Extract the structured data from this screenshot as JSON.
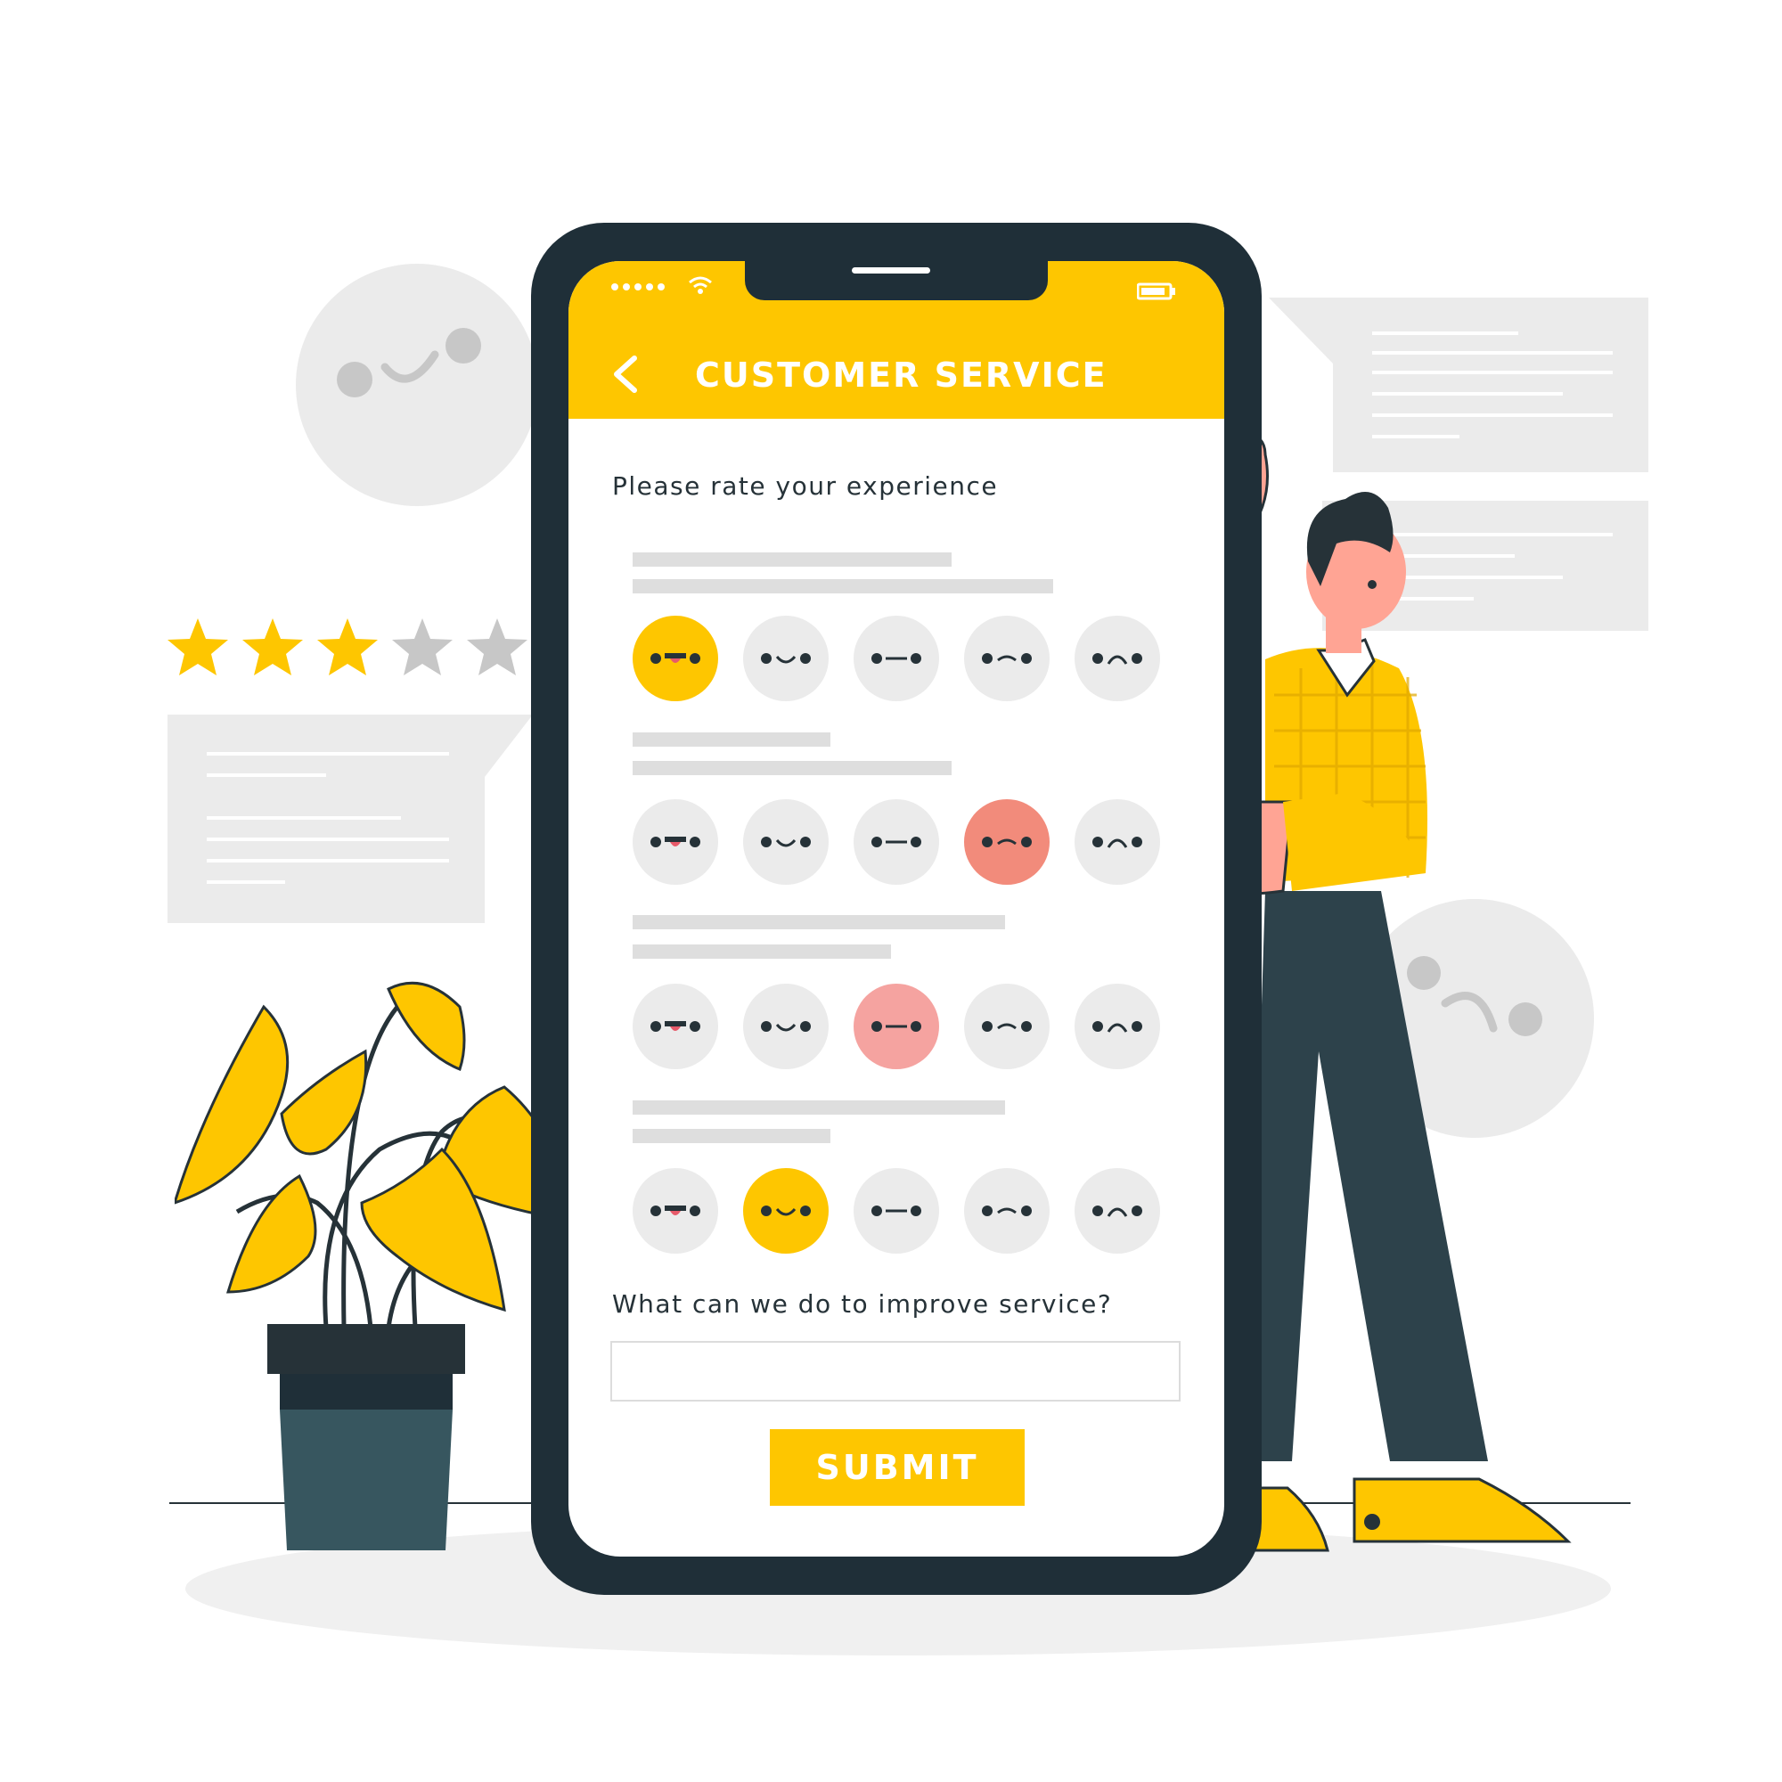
{
  "app": {
    "title": "CUSTOMER SERVICE",
    "back_icon": "chevron-left-icon"
  },
  "status_bar": {
    "signal_icon": "signal-dots-icon",
    "wifi_icon": "wifi-icon",
    "battery_icon": "battery-icon"
  },
  "survey": {
    "rate_prompt": "Please rate your experience",
    "scale": [
      "very-happy",
      "happy",
      "neutral",
      "unhappy",
      "very-unhappy"
    ],
    "questions": [
      {
        "selected_index": 0,
        "selected_color": "#fec600"
      },
      {
        "selected_index": 3,
        "selected_color": "#f28b7b"
      },
      {
        "selected_index": 2,
        "selected_color": "#f5a3a0"
      },
      {
        "selected_index": 1,
        "selected_color": "#fec600"
      }
    ],
    "improve_prompt": "What can we do to improve service?",
    "feedback_value": "",
    "submit_label": "SUBMIT"
  },
  "decorations": {
    "rating_stars": {
      "filled": 3,
      "total": 5
    },
    "icons": [
      "smiley-bubble-icon",
      "sad-bubble-icon",
      "star-icon",
      "chat-bubble-icon",
      "potted-plant-icon",
      "man-thumbs-down-icon"
    ]
  },
  "colors": {
    "accent": "#fec600",
    "phone_frame": "#1f2f38",
    "face_idle": "#ebebeb",
    "face_bad": "#f28b7b",
    "text": "#263238",
    "placeholder_bar": "#dedede"
  }
}
